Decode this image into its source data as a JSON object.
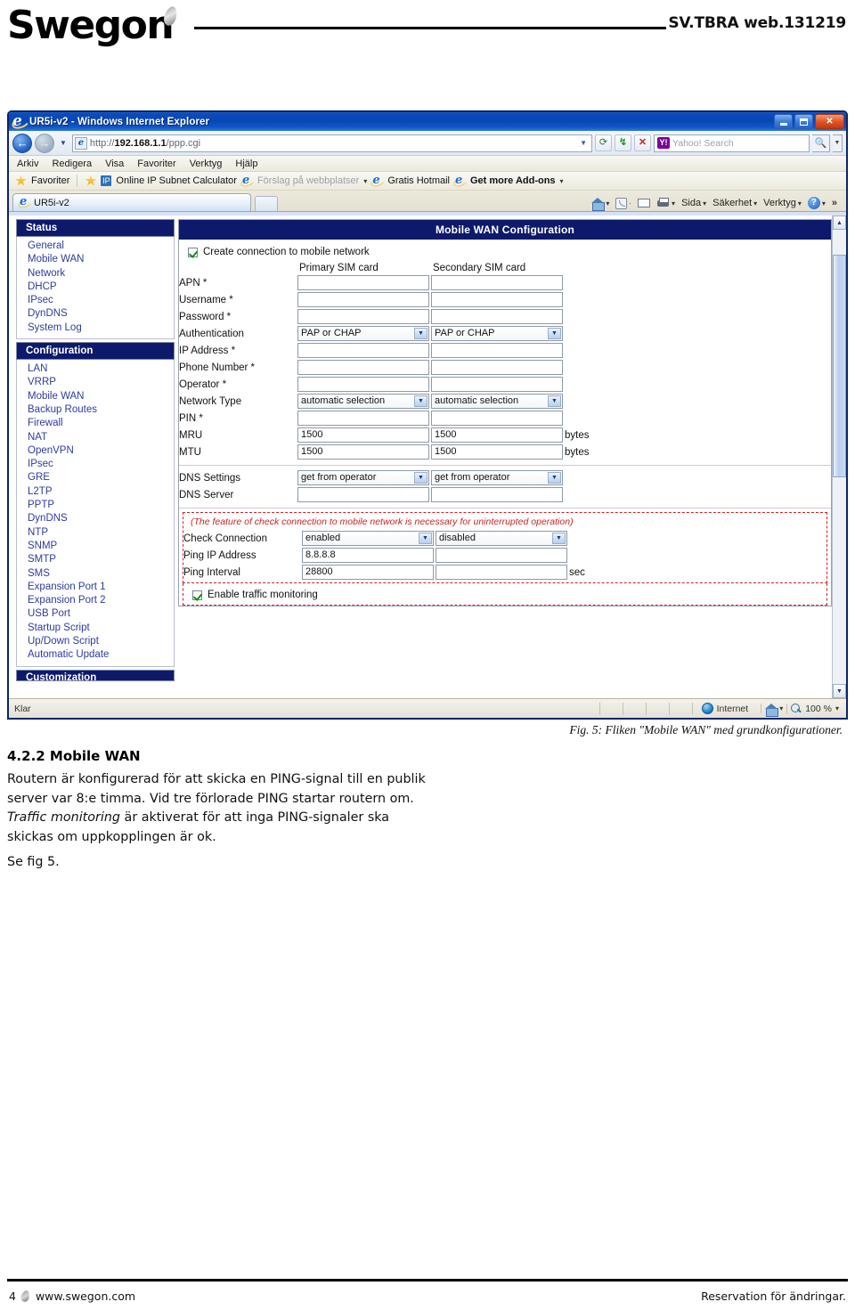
{
  "page_header": {
    "brand": "Swegon",
    "doc_code": "SV.TBRA web.131219"
  },
  "browser": {
    "title": "UR5i-v2 - Windows Internet Explorer",
    "window_buttons": {
      "minimize": "minimize-button",
      "maximize": "maximize-button",
      "close": "close-button"
    },
    "address": {
      "protocol": "http://",
      "host": "192.168.1.1",
      "path": "/ppp.cgi",
      "full": "http://192.168.1.1/ppp.cgi"
    },
    "search": {
      "provider": "Yahoo!",
      "placeholder": "Yahoo! Search",
      "value": ""
    },
    "menu": [
      "Arkiv",
      "Redigera",
      "Visa",
      "Favoriter",
      "Verktyg",
      "Hjälp"
    ],
    "favorites_bar": {
      "label": "Favoriter",
      "items": [
        "Online IP Subnet Calculator",
        "Förslag på webbplatser",
        "Gratis Hotmail",
        "Get more Add-ons"
      ]
    },
    "tab": {
      "label": "UR5i-v2"
    },
    "command_bar": [
      "Sida",
      "Säkerhet",
      "Verktyg"
    ],
    "status_bar": {
      "left": "Klar",
      "zone": "Internet",
      "zoom": "100 %"
    }
  },
  "router": {
    "sidebar": {
      "sections": [
        {
          "title": "Status",
          "items": [
            "General",
            "Mobile WAN",
            "Network",
            "DHCP",
            "IPsec",
            "DynDNS",
            "System Log"
          ]
        },
        {
          "title": "Configuration",
          "items": [
            "LAN",
            "VRRP",
            "Mobile WAN",
            "Backup Routes",
            "Firewall",
            "NAT",
            "OpenVPN",
            "IPsec",
            "GRE",
            "L2TP",
            "PPTP",
            "DynDNS",
            "NTP",
            "SNMP",
            "SMTP",
            "SMS",
            "Expansion Port 1",
            "Expansion Port 2",
            "USB Port",
            "Startup Script",
            "Up/Down Script",
            "Automatic Update"
          ]
        },
        {
          "title": "Customization",
          "items": []
        }
      ]
    },
    "panel": {
      "title": "Mobile WAN Configuration",
      "create_connection": {
        "label": "Create connection to mobile network",
        "checked": true
      },
      "columns": {
        "primary": "Primary SIM card",
        "secondary": "Secondary SIM card"
      },
      "rows": [
        {
          "label": "APN *",
          "type": "text",
          "primary": "",
          "secondary": "",
          "unit": ""
        },
        {
          "label": "Username *",
          "type": "text",
          "primary": "",
          "secondary": "",
          "unit": ""
        },
        {
          "label": "Password *",
          "type": "text",
          "primary": "",
          "secondary": "",
          "unit": ""
        },
        {
          "label": "Authentication",
          "type": "select",
          "primary": "PAP or CHAP",
          "secondary": "PAP or CHAP",
          "unit": ""
        },
        {
          "label": "IP Address *",
          "type": "text",
          "primary": "",
          "secondary": "",
          "unit": ""
        },
        {
          "label": "Phone Number *",
          "type": "text",
          "primary": "",
          "secondary": "",
          "unit": ""
        },
        {
          "label": "Operator *",
          "type": "text",
          "primary": "",
          "secondary": "",
          "unit": ""
        },
        {
          "label": "Network Type",
          "type": "select",
          "primary": "automatic selection",
          "secondary": "automatic selection",
          "unit": ""
        },
        {
          "label": "PIN *",
          "type": "text",
          "primary": "",
          "secondary": "",
          "unit": ""
        },
        {
          "label": "MRU",
          "type": "text",
          "primary": "1500",
          "secondary": "1500",
          "unit": "bytes"
        },
        {
          "label": "MTU",
          "type": "text",
          "primary": "1500",
          "secondary": "1500",
          "unit": "bytes"
        }
      ],
      "dns_rows": [
        {
          "label": "DNS Settings",
          "type": "select",
          "primary": "get from operator",
          "secondary": "get from operator",
          "unit": ""
        },
        {
          "label": "DNS Server",
          "type": "text",
          "primary": "",
          "secondary": "",
          "unit": ""
        }
      ],
      "check_note": "(The feature of check connection to mobile network is necessary for uninterrupted operation)",
      "check_rows": [
        {
          "label": "Check Connection",
          "type": "select",
          "primary": "enabled",
          "secondary": "disabled",
          "unit": ""
        },
        {
          "label": "Ping IP Address",
          "type": "text",
          "primary": "8.8.8.8",
          "secondary": "",
          "unit": ""
        },
        {
          "label": "Ping Interval",
          "type": "text",
          "primary": "28800",
          "secondary": "",
          "unit": "sec"
        }
      ],
      "traffic_monitoring": {
        "label": "Enable traffic monitoring",
        "checked": true
      }
    }
  },
  "figure_caption": "Fig. 5: Fliken \"Mobile WAN\" med grundkonfigurationer.",
  "body": {
    "heading": "4.2.2 Mobile WAN",
    "para1_a": "Routern är konfigurerad för att skicka en PING-signal till en publik server var 8:e timma. Vid tre förlorade PING startar routern om. ",
    "para1_em": "Traffic monitoring",
    "para1_b": " är aktiverat för att inga PING-signaler ska skickas om uppkopplingen är ok.",
    "para2": "Se fig 5."
  },
  "footer": {
    "page_number": "4",
    "site": "www.swegon.com",
    "note": "Reservation för ändringar."
  },
  "colors": {
    "brand_navy": "#0d1a6b",
    "link_blue": "#2d3c9e",
    "warning_red": "#cc2222",
    "title_bar_blue": "#0a46b4"
  }
}
